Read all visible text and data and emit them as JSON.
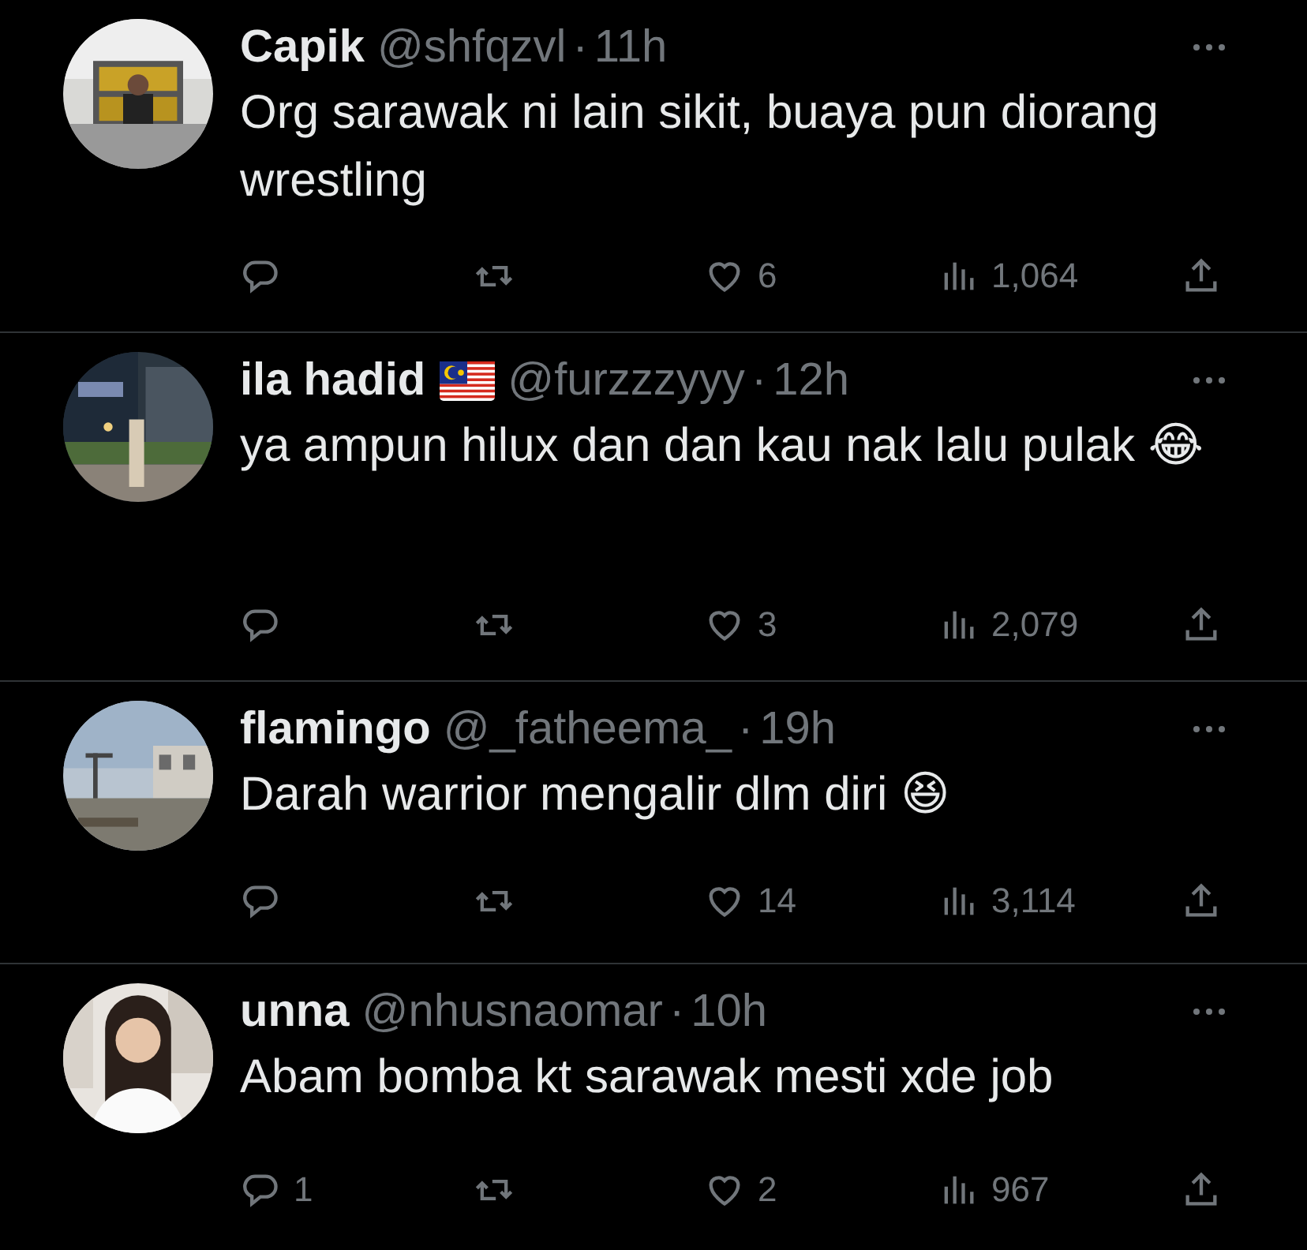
{
  "replies": [
    {
      "name": "Capik",
      "has_flag": false,
      "handle": "@shfqzvl",
      "separator": "·",
      "time": "11h",
      "text": "Org sarawak ni lain sikit, buaya pun diorang wrestling",
      "stats": {
        "likes": "6",
        "views": "1,064"
      }
    },
    {
      "name": "ila hadid",
      "has_flag": true,
      "handle": "@furzzzyyy",
      "separator": "·",
      "time": "12h",
      "text": "ya ampun hilux dan dan kau nak lalu pulak 😂",
      "stats": {
        "likes": "3",
        "views": "2,079"
      }
    },
    {
      "name": "flamingo",
      "has_flag": false,
      "handle": "@_fatheema_",
      "separator": "·",
      "time": "19h",
      "text": "Darah warrior mengalir dlm diri 😆",
      "stats": {
        "likes": "14",
        "views": "3,114"
      }
    },
    {
      "name": "unna",
      "has_flag": false,
      "handle": "@nhusnaomar",
      "separator": "·",
      "time": "10h",
      "text": "Abam bomba kt sarawak mesti xde job",
      "stats": {
        "replies": "1",
        "likes": "2",
        "views": "967"
      }
    }
  ]
}
